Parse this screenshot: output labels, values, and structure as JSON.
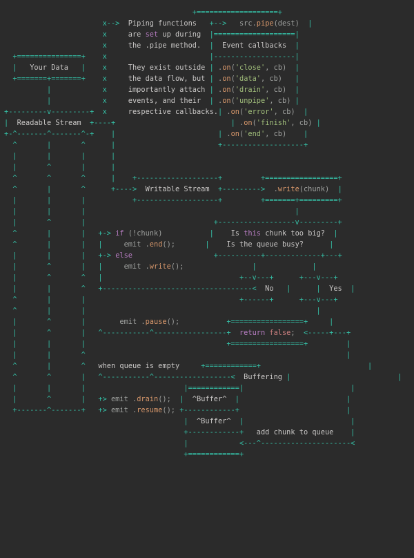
{
  "boxes": {
    "your_data": "Your Data",
    "readable_stream": "Readable Stream",
    "writable_stream": "Writable Stream",
    "event_callbacks": "Event callbacks",
    "buffering": "Buffering",
    "buffer_top": "^Buffer^",
    "buffer_bottom": "^Buffer^",
    "no": "No",
    "yes": "Yes"
  },
  "prose": {
    "piping_functions": "Piping functions",
    "set_up_during": [
      "are ",
      "set",
      " up during"
    ],
    "pipe_method": "the .pipe method.",
    "exist_outside": "They exist outside",
    "data_flow": "the data flow, but",
    "importantly": "importantly attach",
    "events": "events, and their",
    "callbacks": "respective callbacks.",
    "too_big": [
      "Is ",
      "this",
      " chunk too big?"
    ],
    "queue_busy": "Is the queue busy?",
    "queue_empty": "when queue is empty",
    "add_chunk": "add chunk to queue"
  },
  "code": {
    "src_pipe": [
      "src.",
      "pipe",
      "(dest)"
    ],
    "on_close": [
      ".",
      "on",
      "(",
      "'close'",
      ", cb)"
    ],
    "on_data": [
      ".",
      "on",
      "(",
      "'data'",
      ", cb)"
    ],
    "on_drain": [
      ".",
      "on",
      "(",
      "'drain'",
      ", cb)"
    ],
    "on_unpipe": [
      ".",
      "on",
      "(",
      "'unpipe'",
      ", cb)"
    ],
    "on_error": [
      ".",
      "on",
      "(",
      "'error'",
      ", cb)"
    ],
    "on_finish": [
      ".",
      "on",
      "(",
      "'finish'",
      ", cb)"
    ],
    "on_end": [
      ".",
      "on",
      "(",
      "'end'",
      ", cb)"
    ],
    "write_chunk": [
      ".",
      "write",
      "(chunk)"
    ],
    "if_chunk": [
      "if",
      " (!chunk)"
    ],
    "emit_end": [
      "emit .",
      "end",
      "();"
    ],
    "else": "else",
    "emit_write": [
      "emit .",
      "write",
      "();"
    ],
    "emit_pause": [
      "emit .",
      "pause",
      "();"
    ],
    "return_false": [
      "return",
      " ",
      "false",
      ";"
    ],
    "emit_drain": [
      "emit .",
      "drain",
      "();"
    ],
    "emit_resume": [
      "emit .",
      "resume",
      "();"
    ]
  }
}
